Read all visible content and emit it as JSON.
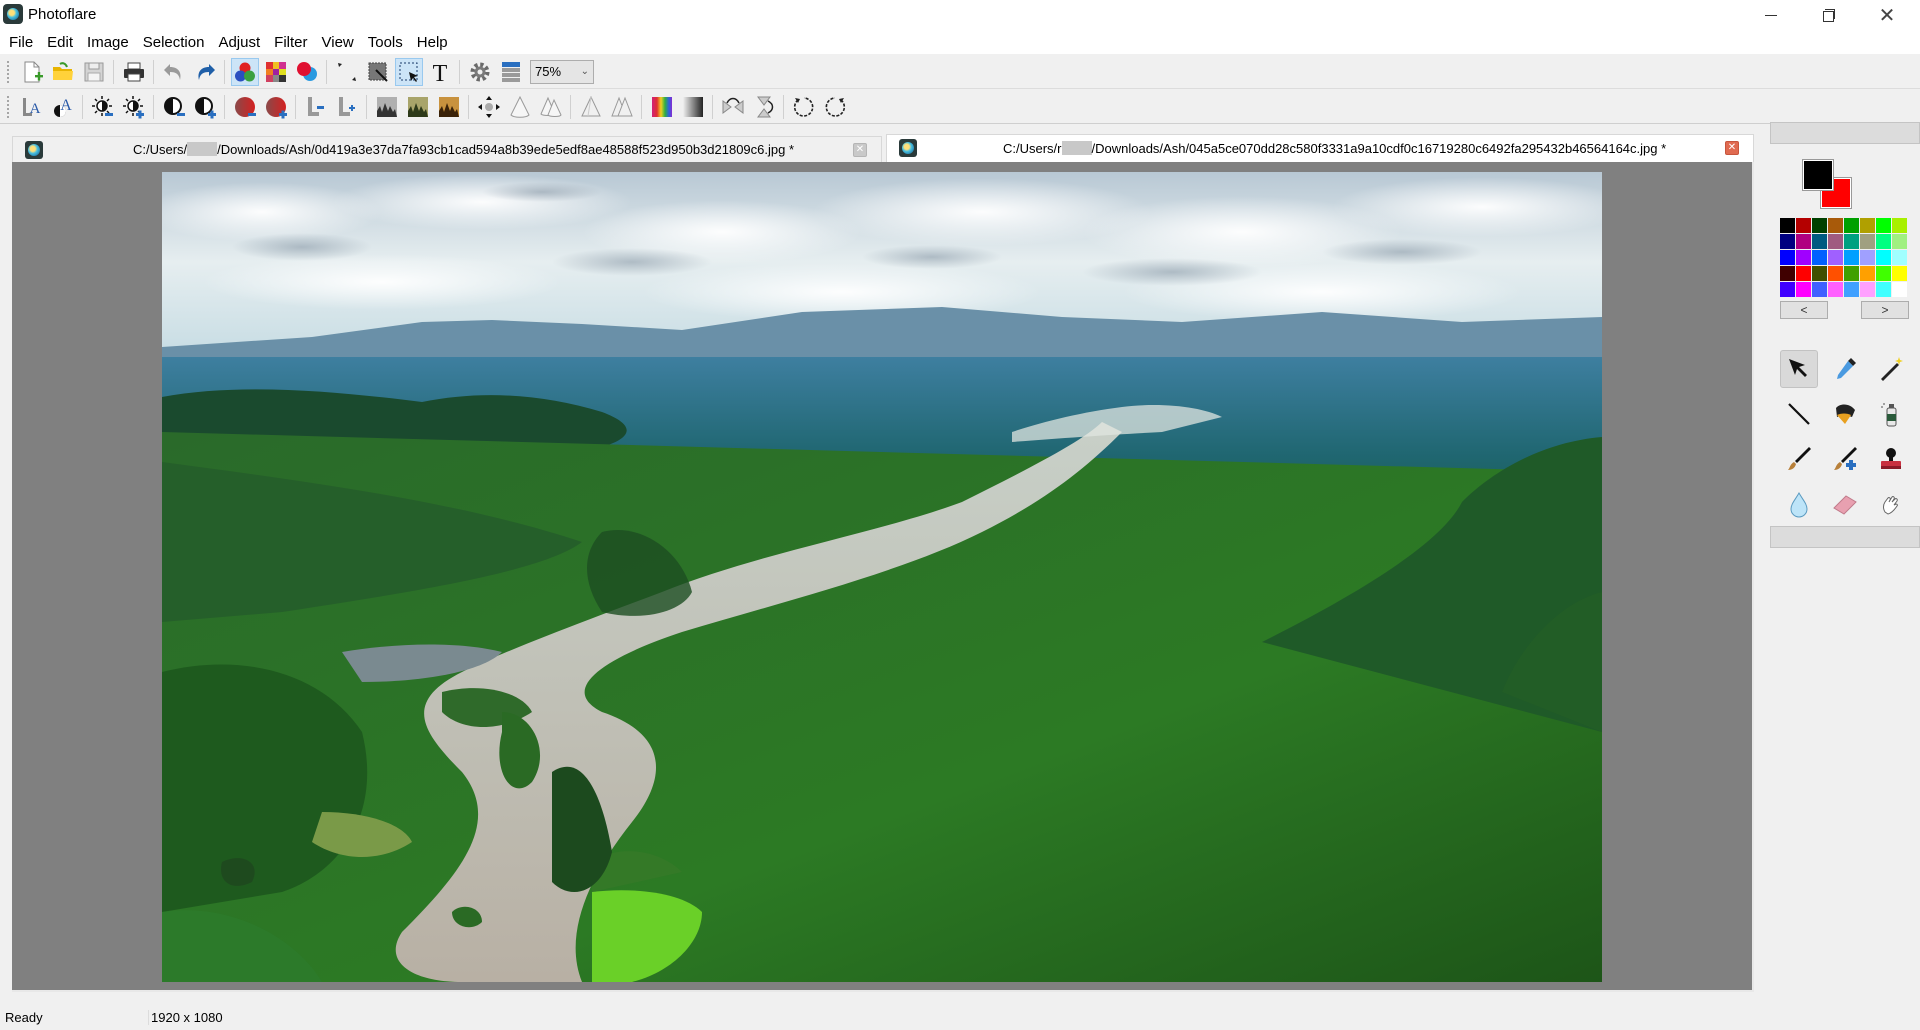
{
  "window": {
    "title": "Photoflare",
    "controls": {
      "minimize": "minimize",
      "maximize": "restore",
      "close": "close"
    }
  },
  "menu": [
    "File",
    "Edit",
    "Image",
    "Selection",
    "Adjust",
    "Filter",
    "View",
    "Tools",
    "Help"
  ],
  "toolbar1": {
    "items": [
      {
        "name": "new-file",
        "icon": "new-document-icon"
      },
      {
        "name": "open-file",
        "icon": "folder-open-icon"
      },
      {
        "name": "save-file",
        "icon": "floppy-disk-icon"
      },
      {
        "name": "print",
        "icon": "printer-icon"
      },
      {
        "name": "undo",
        "icon": "undo-icon"
      },
      {
        "name": "redo",
        "icon": "redo-icon"
      },
      {
        "name": "color-channels",
        "icon": "rgb-circles-icon",
        "active": true
      },
      {
        "name": "mosaic",
        "icon": "mosaic-icon"
      },
      {
        "name": "red-blue-filter",
        "icon": "red-blue-circles-icon"
      },
      {
        "name": "resize-image",
        "icon": "resize-arrow-icon"
      },
      {
        "name": "resize-canvas",
        "icon": "canvas-resize-icon"
      },
      {
        "name": "selection",
        "icon": "selection-rect-icon",
        "active": true
      },
      {
        "name": "text",
        "icon": "text-icon"
      },
      {
        "name": "settings",
        "icon": "gear-icon"
      },
      {
        "name": "layers",
        "icon": "layers-list-icon"
      }
    ],
    "zoom": {
      "value": "75%"
    }
  },
  "toolbar2": {
    "items": [
      {
        "name": "font-size-down",
        "icon": "text-A-icon"
      },
      {
        "name": "text-outline",
        "icon": "text-A-contrast-icon"
      },
      {
        "name": "brightness-down",
        "icon": "brightness-minus-icon"
      },
      {
        "name": "brightness-up",
        "icon": "brightness-plus-icon"
      },
      {
        "name": "contrast-down",
        "icon": "contrast-minus-icon"
      },
      {
        "name": "contrast-up",
        "icon": "contrast-plus-icon"
      },
      {
        "name": "saturation-down",
        "icon": "saturation-minus-icon"
      },
      {
        "name": "saturation-up",
        "icon": "saturation-plus-icon"
      },
      {
        "name": "gamma-down",
        "icon": "gamma-minus-icon"
      },
      {
        "name": "gamma-up",
        "icon": "gamma-plus-icon"
      },
      {
        "name": "grayscale",
        "icon": "grayscale-landscape-icon"
      },
      {
        "name": "old-photo",
        "icon": "olive-landscape-icon"
      },
      {
        "name": "sepia",
        "icon": "sepia-landscape-icon"
      },
      {
        "name": "move",
        "icon": "move-arrows-icon"
      },
      {
        "name": "sharpen",
        "icon": "cone-icon"
      },
      {
        "name": "sharpen-more",
        "icon": "double-cone-icon"
      },
      {
        "name": "blur",
        "icon": "triangle-icon"
      },
      {
        "name": "blur-more",
        "icon": "double-triangle-icon"
      },
      {
        "name": "color-gradient",
        "icon": "rainbow-gradient-icon"
      },
      {
        "name": "gray-gradient",
        "icon": "gray-gradient-icon"
      },
      {
        "name": "flip-horizontal",
        "icon": "flip-horizontal-icon"
      },
      {
        "name": "flip-vertical",
        "icon": "flip-vertical-icon"
      },
      {
        "name": "rotate-ccw",
        "icon": "rotate-ccw-icon"
      },
      {
        "name": "rotate-cw",
        "icon": "rotate-cw-icon"
      }
    ]
  },
  "tabs": [
    {
      "path_prefix": "C:/Users/",
      "path_suffix": "/Downloads/Ash/0d419a3e37da7fa93cb1cad594a8b39ede5edf8ae48588f523d950b3d21809c6.jpg *",
      "active": false
    },
    {
      "path_prefix": "C:/Users/r",
      "path_suffix": "/Downloads/Ash/045a5ce070dd28c580f3331a9a10cdf0c16719280c6492fa295432b46564164c.jpg *",
      "active": true
    }
  ],
  "colors": {
    "primary": "#000000",
    "secondary": "#ff0000",
    "palette": [
      "#000000",
      "#b40000",
      "#004000",
      "#a85a0a",
      "#00a000",
      "#b0a000",
      "#00ff00",
      "#a8f000",
      "#000080",
      "#b00080",
      "#005a80",
      "#a05a80",
      "#00a080",
      "#a0a080",
      "#00ff80",
      "#a0f080",
      "#0000ff",
      "#a000ff",
      "#0060ff",
      "#a060ff",
      "#00a0ff",
      "#a0a0ff",
      "#00ffff",
      "#a0ffff",
      "#400000",
      "#ff0000",
      "#405000",
      "#ff5000",
      "#40a000",
      "#ffa000",
      "#40ff00",
      "#ffff00",
      "#4000ff",
      "#ff00ff",
      "#4060ff",
      "#ff60ff",
      "#40a0ff",
      "#ffa0ff",
      "#40ffff",
      "#ffffff"
    ],
    "prev_label": "<",
    "next_label": ">"
  },
  "tools": [
    {
      "name": "pointer",
      "icon": "pointer-arrow-icon",
      "active": true
    },
    {
      "name": "color-picker",
      "icon": "eyedropper-icon"
    },
    {
      "name": "magic-wand",
      "icon": "magic-wand-icon"
    },
    {
      "name": "line",
      "icon": "line-icon"
    },
    {
      "name": "paint-bucket",
      "icon": "paint-bucket-icon"
    },
    {
      "name": "spray-can",
      "icon": "spray-can-icon"
    },
    {
      "name": "paintbrush",
      "icon": "paintbrush-icon"
    },
    {
      "name": "smart-brush",
      "icon": "paintbrush-plus-icon"
    },
    {
      "name": "stamp",
      "icon": "stamp-icon"
    },
    {
      "name": "blur-drop",
      "icon": "water-drop-icon"
    },
    {
      "name": "eraser",
      "icon": "eraser-icon"
    },
    {
      "name": "smudge",
      "icon": "smudge-hand-icon"
    }
  ],
  "status": {
    "text": "Ready",
    "dimensions": "1920 x 1080"
  }
}
